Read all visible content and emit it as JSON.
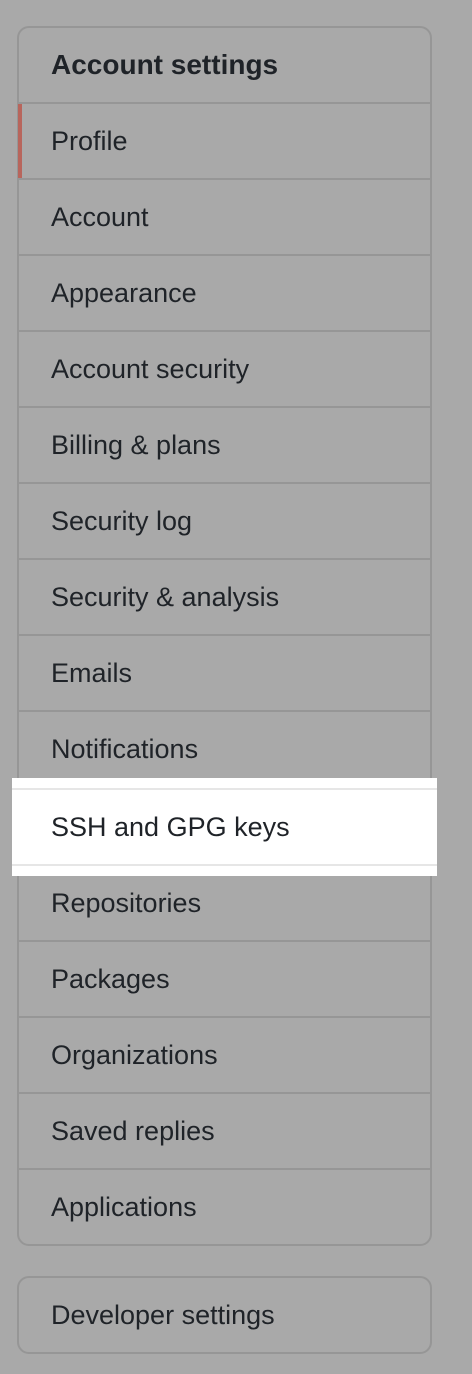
{
  "account_settings": {
    "heading": "Account settings",
    "items": [
      {
        "label": "Profile",
        "name": "profile",
        "selected": true
      },
      {
        "label": "Account",
        "name": "account"
      },
      {
        "label": "Appearance",
        "name": "appearance"
      },
      {
        "label": "Account security",
        "name": "account-security"
      },
      {
        "label": "Billing & plans",
        "name": "billing-plans"
      },
      {
        "label": "Security log",
        "name": "security-log"
      },
      {
        "label": "Security & analysis",
        "name": "security-analysis"
      },
      {
        "label": "Emails",
        "name": "emails"
      },
      {
        "label": "Notifications",
        "name": "notifications"
      },
      {
        "label": "SSH and GPG keys",
        "name": "ssh-gpg-keys",
        "highlighted": true
      },
      {
        "label": "Repositories",
        "name": "repositories"
      },
      {
        "label": "Packages",
        "name": "packages"
      },
      {
        "label": "Organizations",
        "name": "organizations"
      },
      {
        "label": "Saved replies",
        "name": "saved-replies"
      },
      {
        "label": "Applications",
        "name": "applications"
      }
    ]
  },
  "developer_settings": {
    "label": "Developer settings"
  },
  "colors": {
    "selected_indicator": "#b8655c",
    "highlight_background": "#ffffff",
    "dimmed_background": "#a9a9a9"
  }
}
